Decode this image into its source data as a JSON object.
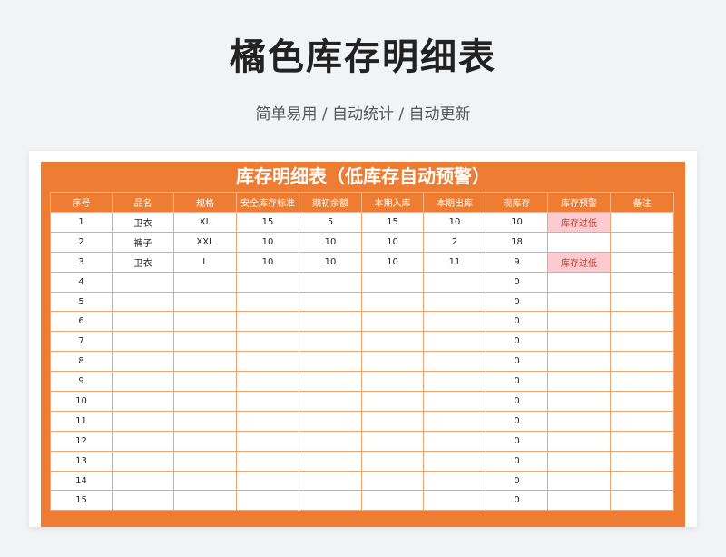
{
  "page": {
    "title": "橘色库存明细表",
    "subtitle": "简单易用 / 自动统计 / 自动更新"
  },
  "sheet": {
    "title": "库存明细表（低库存自动预警）",
    "columns": [
      "序号",
      "品名",
      "规格",
      "安全库存标准",
      "期初余额",
      "本期入库",
      "本期出库",
      "现库存",
      "库存预警",
      "备注"
    ],
    "rows": [
      [
        "1",
        "卫衣",
        "XL",
        "15",
        "5",
        "15",
        "10",
        "10",
        "库存过低",
        ""
      ],
      [
        "2",
        "裤子",
        "XXL",
        "10",
        "10",
        "10",
        "2",
        "18",
        "",
        ""
      ],
      [
        "3",
        "卫衣",
        "L",
        "10",
        "10",
        "10",
        "11",
        "9",
        "库存过低",
        ""
      ],
      [
        "4",
        "",
        "",
        "",
        "",
        "",
        "",
        "0",
        "",
        ""
      ],
      [
        "5",
        "",
        "",
        "",
        "",
        "",
        "",
        "0",
        "",
        ""
      ],
      [
        "6",
        "",
        "",
        "",
        "",
        "",
        "",
        "0",
        "",
        ""
      ],
      [
        "7",
        "",
        "",
        "",
        "",
        "",
        "",
        "0",
        "",
        ""
      ],
      [
        "8",
        "",
        "",
        "",
        "",
        "",
        "",
        "0",
        "",
        ""
      ],
      [
        "9",
        "",
        "",
        "",
        "",
        "",
        "",
        "0",
        "",
        ""
      ],
      [
        "10",
        "",
        "",
        "",
        "",
        "",
        "",
        "0",
        "",
        ""
      ],
      [
        "11",
        "",
        "",
        "",
        "",
        "",
        "",
        "0",
        "",
        ""
      ],
      [
        "12",
        "",
        "",
        "",
        "",
        "",
        "",
        "0",
        "",
        ""
      ],
      [
        "13",
        "",
        "",
        "",
        "",
        "",
        "",
        "0",
        "",
        ""
      ],
      [
        "14",
        "",
        "",
        "",
        "",
        "",
        "",
        "0",
        "",
        ""
      ],
      [
        "15",
        "",
        "",
        "",
        "",
        "",
        "",
        "0",
        "",
        ""
      ]
    ]
  },
  "colors": {
    "accent": "#ee7d33",
    "warning_bg": "#fbcbcf",
    "warning_text": "#c0392b"
  }
}
